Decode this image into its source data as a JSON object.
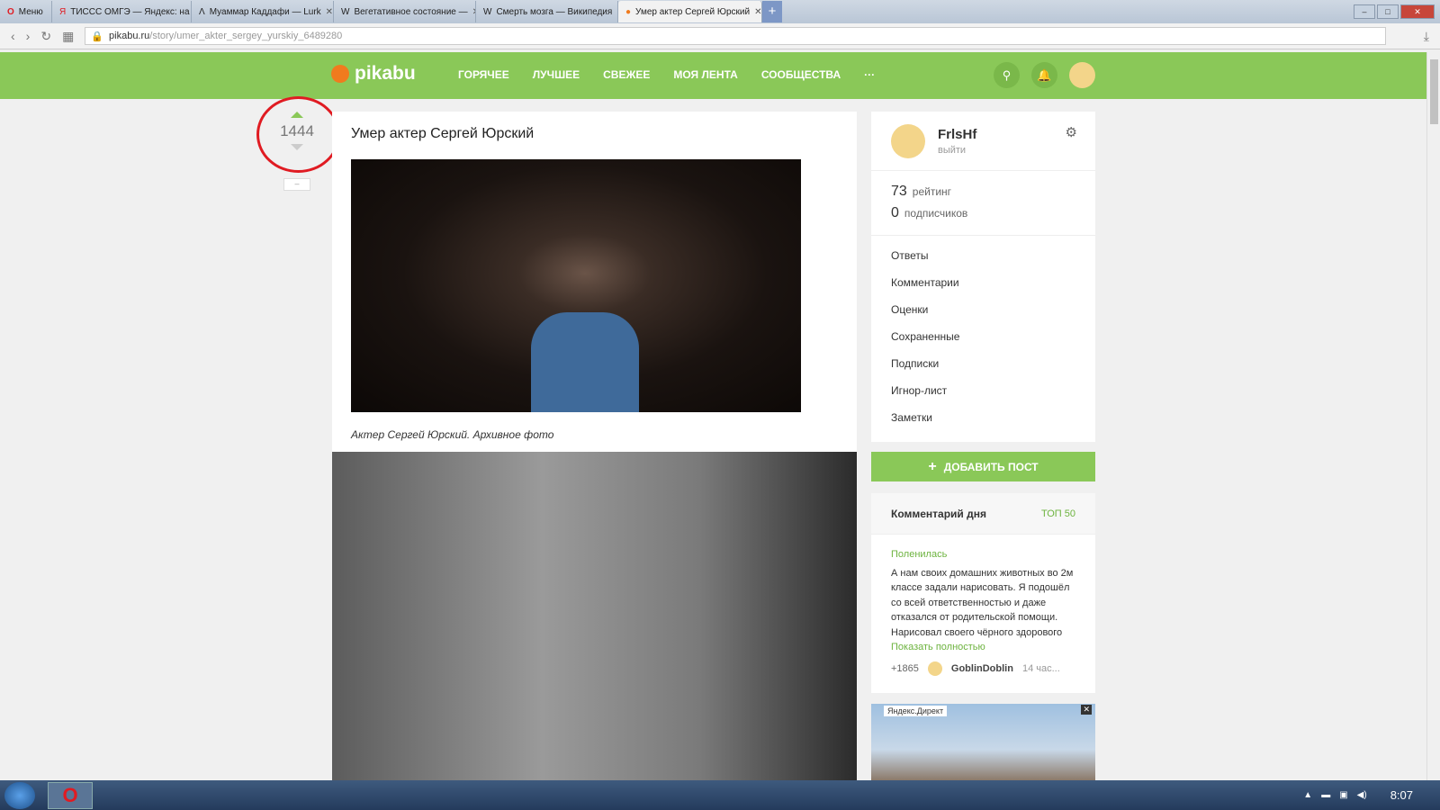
{
  "browser": {
    "menu": "Меню",
    "tabs": [
      {
        "icon": "Я",
        "title": "ТИССС ОМГЭ — Яндекс: на"
      },
      {
        "icon": "Λ",
        "title": "Муаммар Каддафи — Lurk"
      },
      {
        "icon": "W",
        "title": "Вегетативное состояние —"
      },
      {
        "icon": "W",
        "title": "Смерть мозга — Википедия"
      },
      {
        "icon": "●",
        "title": "Умер актер Сергей Юрский"
      }
    ],
    "url_host": "pikabu.ru",
    "url_path": "/story/umer_akter_sergey_yurskiy_6489280"
  },
  "header": {
    "logo": "pikabu",
    "nav": [
      "ГОРЯЧЕЕ",
      "ЛУЧШЕЕ",
      "СВЕЖЕЕ",
      "МОЯ ЛЕНТА",
      "СООБЩЕСТВА",
      "···"
    ]
  },
  "post": {
    "rating": "1444",
    "minus": "–",
    "title": "Умер актер Сергей Юрский",
    "caption": "Актер Сергей Юрский. Архивное фото"
  },
  "user": {
    "name": "FrlsHf",
    "logout": "выйти",
    "rating": "73",
    "rating_label": "рейтинг",
    "subs": "0",
    "subs_label": "подписчиков",
    "menu": [
      "Ответы",
      "Комментарии",
      "Оценки",
      "Сохраненные",
      "Подписки",
      "Игнор-лист",
      "Заметки"
    ]
  },
  "add_post": "ДОБАВИТЬ ПОСТ",
  "comment_of_day": {
    "title": "Комментарий дня",
    "top": "ТОП 50",
    "post": "Поленилась",
    "text": "А нам своих домашних животных во 2м классе задали нарисовать. Я подошёл со всей ответственностью и даже отказался от родительской помощи. Нарисовал своего чёрного здорового",
    "more": "Показать полностью",
    "score": "+1865",
    "author": "GoblinDoblin",
    "time": "14 час..."
  },
  "ad": {
    "label": "Яндекс.Директ",
    "close": "✕"
  },
  "taskbar": {
    "time": "8:07"
  }
}
